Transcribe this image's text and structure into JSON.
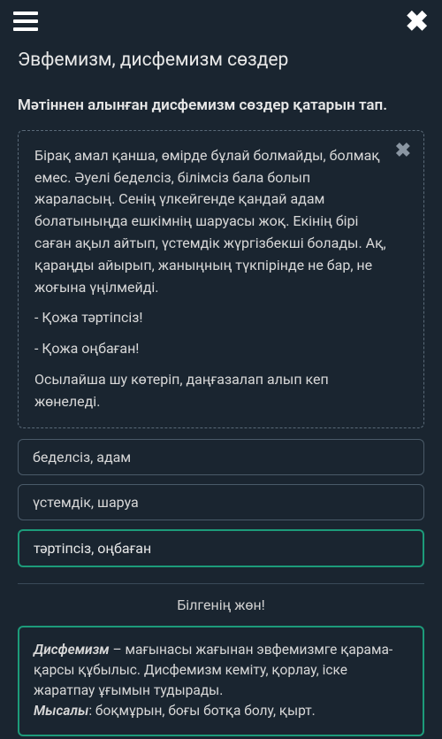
{
  "page_title": "Эвфемизм, дисфемизм сөздер",
  "instruction": "Мәтіннен алынған дисфемизм сөздер қатарын тап.",
  "passage": {
    "paragraphs": [
      "Бірақ амал қанша, өмірде бұлай болмайды, болмақ емес. Әуелі беделсіз, білімсіз бала болып жараласың. Сенің үлкейгенде қандай адам болатыныңда ешкімнің шаруасы жоқ. Екінің бірі саған ақыл айтып, үстемдік жүргізбекші болады. Ақ, қараңды айырып, жаныңның түкпірінде не бар, не жоғына үңілмейді.",
      "- Қожа тәртіпсіз!",
      "- Қожа оңбаған!",
      "Осылайша шу көтеріп, даңғазалап алып кеп жөнеледі."
    ]
  },
  "options": [
    {
      "label": "беделсіз, адам",
      "correct": false
    },
    {
      "label": "үстемдік, шаруа",
      "correct": false
    },
    {
      "label": "тәртіпсіз, оңбаған",
      "correct": true
    }
  ],
  "hint_title": "Білгенің жөн!",
  "info": {
    "term1": "Дисфемизм",
    "def1": " – мағынасы жағынан эвфемизмге қарама-қарсы құбылыс. Дисфемизм кеміту, қорлау, іске жаратпау ұғымын тудырады.",
    "term2": "Мысалы",
    "def2": ": боқмұрын, боғы ботқа болу, қырт."
  }
}
